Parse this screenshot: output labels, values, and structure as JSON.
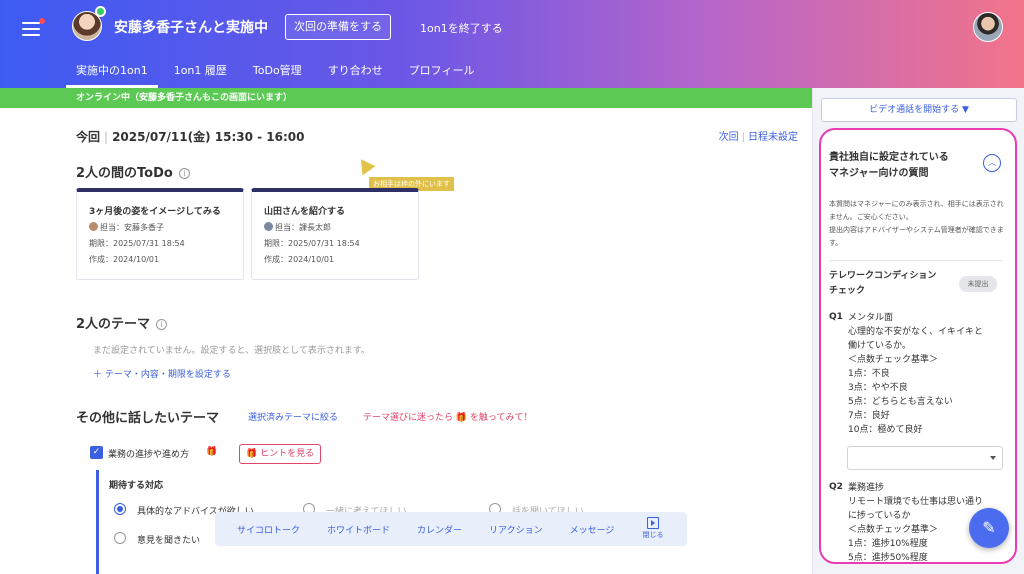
{
  "header": {
    "session_title": "安藤多香子さんと実施中",
    "prepare_button": "次回の準備をする",
    "end_button": "1on1を終了する",
    "tabs": [
      {
        "label": "実施中の1on1",
        "active": true
      },
      {
        "label": "1on1 履歴"
      },
      {
        "label": "ToDo管理"
      },
      {
        "label": "すり合わせ"
      },
      {
        "label": "プロフィール"
      }
    ]
  },
  "status_bar": "オンライン中（安藤多香子さんもこの画面にいます）",
  "session": {
    "label": "今回",
    "datetime": "2025/07/11(金) 15:30 - 16:00",
    "next_label": "次回",
    "next_value": "日程未設定"
  },
  "todo": {
    "title": "2人の間のToDo",
    "info": "i",
    "pointer_tag": "お相手は枠の外にいます",
    "cards": [
      {
        "title": "3ヶ月後の姿をイメージしてみる",
        "assignee": "担当：安藤多香子",
        "due": "期限：2025/07/31 18:54",
        "created": "作成：2024/10/01"
      },
      {
        "title": "山田さんを紹介する",
        "assignee": "担当：課長太郎",
        "due": "期限：2025/07/31 18:54",
        "created": "作成：2024/10/01"
      }
    ]
  },
  "theme": {
    "title": "2人のテーマ",
    "info": "i",
    "empty": "まだ設定されていません。設定すると、選択肢として表示されます。",
    "add": "＋  テーマ・内容・期限を設定する"
  },
  "other": {
    "title": "その他に話したいテーマ",
    "filter_link": "選択済みテーマに絞る",
    "hint_link": "テーマ選びに迷ったら 🎁 を触ってみて！",
    "checked_item": "業務の進捗や進め方",
    "gift": "🎁",
    "hint_button": "🎁 ヒントを見る",
    "expect_title": "期待する対応",
    "radios": [
      {
        "label": "具体的なアドバイスが欲しい",
        "selected": true
      },
      {
        "label": "一緒に考えてほしい",
        "selected": false
      },
      {
        "label": "話を聞いてほしい",
        "selected": false
      },
      {
        "label": "意見を聞きたい",
        "selected": false
      }
    ]
  },
  "toolbar": {
    "items": [
      "サイコロトーク",
      "ホワイトボード",
      "カレンダー",
      "リアクション",
      "メッセージ"
    ],
    "close": "閉じる"
  },
  "right_panel": {
    "video_button": "ビデオ通話を開始する ▼",
    "title": "貴社独自に設定されている\nマネジャー向けの質問",
    "toggle": "︿",
    "description": "本質問はマネジャーにのみ表示され、相手には表示されません。ご安心ください。\n提出内容はアドバイザーやシステム管理者が確認できます。",
    "subtitle": "テレワークコンディション\nチェック",
    "badge": "未提出",
    "q1_no": "Q1",
    "q1_lines": [
      "メンタル面",
      "心理的な不安がなく、イキイキと",
      "働けているか。",
      "＜点数チェック基準＞",
      "1点：不良",
      "3点：やや不良",
      "5点：どちらとも言えない",
      "7点：良好",
      "10点：極めて良好"
    ],
    "q2_no": "Q2",
    "q2_lines": [
      "業務進捗",
      "リモート環境でも仕事は思い通り",
      "に捗っているか",
      "＜点数チェック基準＞",
      "1点：進捗10%程度",
      "5点：進捗50%程度"
    ],
    "fab": "✎"
  },
  "colors": {
    "accent": "#3a5fe0",
    "status_green": "#5cc954",
    "highlight_pink": "#e93bb3",
    "pink_text": "#e0456a"
  }
}
